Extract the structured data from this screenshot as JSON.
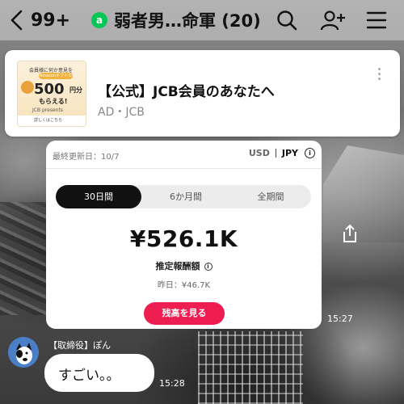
{
  "header": {
    "unread_count": "99+",
    "chat_title": "弱者男…命軍 (20)",
    "chat_icon_letter": "a"
  },
  "ad": {
    "title": "【公式】JCB会員のあなたへ",
    "subtitle": "AD・JCB",
    "thumbnail": {
      "top_text": "会員様に何か意見を",
      "amazon_text": "Amazonギフトカード",
      "amount": "500",
      "amount_unit": "円分",
      "get_text": "もらえる!",
      "brand_text": "JCB presents",
      "bottom_text": "詳しくはこちら"
    }
  },
  "share_card": {
    "updated": "最終更新日：10/7",
    "currency_usd": "USD",
    "currency_jpy": "JPY",
    "tabs": [
      "30日間",
      "6か月間",
      "全期間"
    ],
    "active_tab": "30日間",
    "amount": "¥526.1K",
    "amount_label": "推定報酬額",
    "yesterday": "昨日：¥46.7K",
    "balance_button": "残高を見る"
  },
  "message_time_1": "15:27",
  "message2": {
    "sender": "【取締役】ぽん",
    "text": "すごい。。",
    "time": "15:28"
  },
  "colors": {
    "accent_line_green": "#06c755",
    "balance_button": "#ee1d52",
    "tab_active_bg": "#111111"
  }
}
